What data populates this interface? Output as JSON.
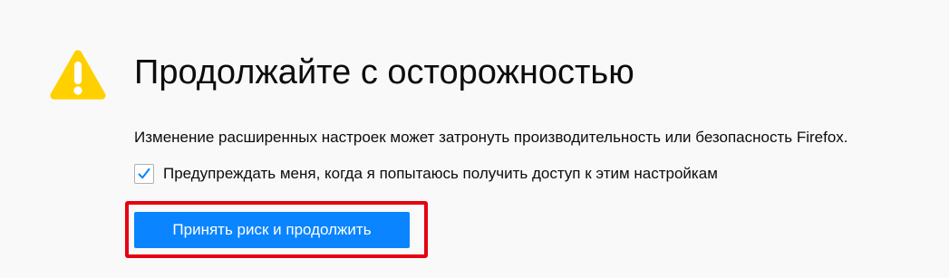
{
  "page": {
    "title": "Продолжайте с осторожностью",
    "description": "Изменение расширенных настроек может затронуть производительность или безопасность Firefox.",
    "checkbox": {
      "label": "Предупреждать меня, когда я попытаюсь получить доступ к этим настройкам",
      "checked": true
    },
    "button_label": "Принять риск и продолжить"
  },
  "icons": {
    "warning": "warning-icon",
    "checkmark": "checkmark-icon"
  },
  "colors": {
    "background": "#f9f9fa",
    "warning_yellow": "#ffd000",
    "primary_button": "#0a84ff",
    "checkmark_blue": "#0a84ff",
    "highlight_red": "#e60012",
    "text": "#0c0c0d"
  }
}
